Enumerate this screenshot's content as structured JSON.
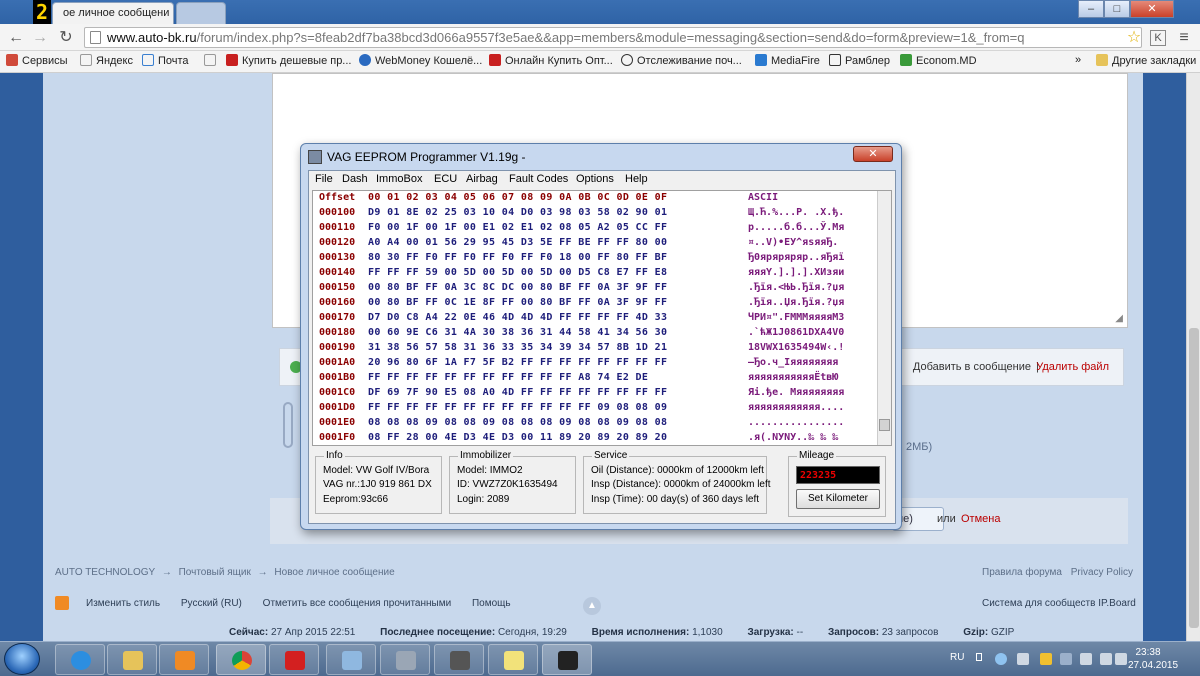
{
  "browser": {
    "active_tab_title": "ое личное сообщени",
    "window_controls": {
      "minimize": "–",
      "maximize": "□",
      "close": "✕"
    },
    "app_badge": "2",
    "url_host": "www.auto-bk.ru",
    "url_path": "/forum/index.php?s=8feab2df7ba38bcd3d066a9557f3e5ae&&app=members&module=messaging&section=send&do=form&preview=1&_from=q",
    "bookmarks": [
      "Сервисы",
      "Яндекс",
      "Почта",
      "Купить дешевые пр...",
      "WebMoney Кошелё...",
      "Онлайн Купить Опт...",
      "Отслеживание поч...",
      "MediaFire",
      "Рамблер",
      "Econom.MD"
    ],
    "bookmarks_overflow": "»",
    "other_bookmarks": "Другие закладки"
  },
  "forum": {
    "attach_add": "Добавить в сообщение",
    "attach_sep": "|",
    "attach_delete": "Удалить файл",
    "size_note": "2МБ)",
    "preview_button_partial": "ue)",
    "or_text": "или",
    "cancel": "Отмена",
    "breadcrumb": [
      "AUTO TECHNOLOGY",
      "Почтовый ящик",
      "Новое личное сообщение"
    ],
    "breadcrumb_sep": "→",
    "rules": "Правила форума",
    "privacy": "Privacy Policy",
    "footer_links": [
      "Изменить стиль",
      "Русский (RU)",
      "Отметить все сообщения прочитанными",
      "Помощь"
    ],
    "ipboard": "Система для сообществ IP.Board",
    "stats": [
      {
        "label": "Сейчас:",
        "value": "27 Апр 2015 22:51"
      },
      {
        "label": "Последнее посещение:",
        "value": "Сегодня, 19:29"
      },
      {
        "label": "Время исполнения:",
        "value": "1,1030"
      },
      {
        "label": "Загрузка:",
        "value": "--"
      },
      {
        "label": "Запросов:",
        "value": "23 запросов"
      },
      {
        "label": "Gzip:",
        "value": "GZIP"
      }
    ]
  },
  "vag": {
    "title": "VAG EEPROM Programmer  V1.19g -",
    "close_label": "✕",
    "menu": [
      "File",
      "Dash",
      "ImmoBox",
      "ECU",
      "Airbag",
      "Fault Codes",
      "Options",
      "Help"
    ],
    "hex_header": {
      "offset": "Offset",
      "bytes": "00 01 02 03 04 05 06 07 08 09 0A 0B 0C 0D 0E 0F",
      "ascii": "ASCII"
    },
    "hex_rows": [
      {
        "offset": "000100",
        "bytes": "D9 01 8E 02 25 03 10 04 D0 03 98 03 58 02 90 01",
        "ascii": "Щ.Ћ.%...Р. .Х.ђ."
      },
      {
        "offset": "000110",
        "bytes": "F0 00 1F 00 1F 00 E1 02 E1 02 08 05 A2 05 CC FF",
        "ascii": "р.....б.б...Ў.Мя"
      },
      {
        "offset": "000120",
        "bytes": "A0 A4 00 01 56 29 95 45 D3 5E FF BE FF FF 80 00",
        "ascii": " ¤..V)•EУ^яѕяяЂ."
      },
      {
        "offset": "000130",
        "bytes": "80 30 FF F0 FF F0 FF F0 FF F0 18 00 FF 80 FF BF",
        "ascii": "Ђ0яряряряр..яЂяї"
      },
      {
        "offset": "000140",
        "bytes": "FF FF FF 59 00 5D 00 5D 00 5D 00 D5 C8 E7 FF E8",
        "ascii": "яяяY.].].].ХИзяи"
      },
      {
        "offset": "000150",
        "bytes": "00 80 BF FF 0A 3C 8C DC 00 80 BF FF 0A 3F 9F FF",
        "ascii": ".Ђїя.<ЊЬ.Ђїя.?џя"
      },
      {
        "offset": "000160",
        "bytes": "00 80 BF FF 0C 1E 8F FF 00 80 BF FF 0A 3F 9F FF",
        "ascii": ".Ђїя..Џя.Ђїя.?џя"
      },
      {
        "offset": "000170",
        "bytes": "D7 D0 C8 A4 22 0E 46 4D 4D 4D FF FF FF FF 4D 33",
        "ascii": "ЧРИ¤\".FMMMяяяяM3"
      },
      {
        "offset": "000180",
        "bytes": "00 60 9E C6 31 4A 30 38 36 31 44 58 41 34 56 30",
        "ascii": ".`ћЖ1J0861DXA4V0"
      },
      {
        "offset": "000190",
        "bytes": "31 38 56 57 58 31 36 33 35 34 39 34 57 8B 1D 21",
        "ascii": "18VWX1635494W‹.!"
      },
      {
        "offset": "0001A0",
        "bytes": "20 96 80 6F 1A F7 5F B2 FF FF FF FF FF FF FF FF",
        "ascii": " –Ђo.ч_Іяяяяяяяя"
      },
      {
        "offset": "0001B0",
        "bytes": "FF FF FF FF FF FF FF FF FF FF FF A8 74 E2 DE",
        "ascii": "яяяяяяяяяяяЁtвЮ"
      },
      {
        "offset": "0001C0",
        "bytes": "DF 69 7F 90 E5 08 A0 4D FF FF FF FF FF FF FF FF",
        "ascii": "Яi.ђе. Mяяяяяяяя"
      },
      {
        "offset": "0001D0",
        "bytes": "FF FF FF FF FF FF FF FF FF FF FF FF 09 08 08 09",
        "ascii": "яяяяяяяяяяяя...."
      },
      {
        "offset": "0001E0",
        "bytes": "08 08 08 09 08 08 09 08 08 08 09 08 08 09 08 08",
        "ascii": "................"
      },
      {
        "offset": "0001F0",
        "bytes": "08 FF 28 00 4E D3 4E D3 00 11 89 20 89 20 89 20",
        "ascii": ".я(.NУNУ..‰ ‰ ‰ "
      }
    ],
    "info": {
      "title": "Info",
      "model": "Model:  VW Golf IV/Bora",
      "vag_nr": "VAG nr.:1J0 919 861 DX",
      "eeprom": "Eeprom:93c66"
    },
    "immobilizer": {
      "title": "Immobilizer",
      "model": "Model:  IMMO2",
      "id": "ID: VWZ7Z0K1635494",
      "login": "Login: 2089"
    },
    "service": {
      "title": "Service",
      "oil": "Oil (Distance):   0000km of 12000km left",
      "insp_distance": "Insp (Distance): 0000km of 24000km left",
      "insp_time": "Insp (Time):       00 day(s) of 360 days left"
    },
    "mileage": {
      "title": "Mileage",
      "value": "223235",
      "button": "Set Kilometer"
    }
  },
  "taskbar": {
    "lang": "RU",
    "time": "23:38",
    "date": "27.04.2015"
  },
  "colors": {
    "desktop": "#2f5e9e",
    "hex_offset": "#8b0000",
    "hex_bytes": "#1d1d7a",
    "hex_ascii": "#7a1a7a",
    "link_red": "#b00000"
  }
}
